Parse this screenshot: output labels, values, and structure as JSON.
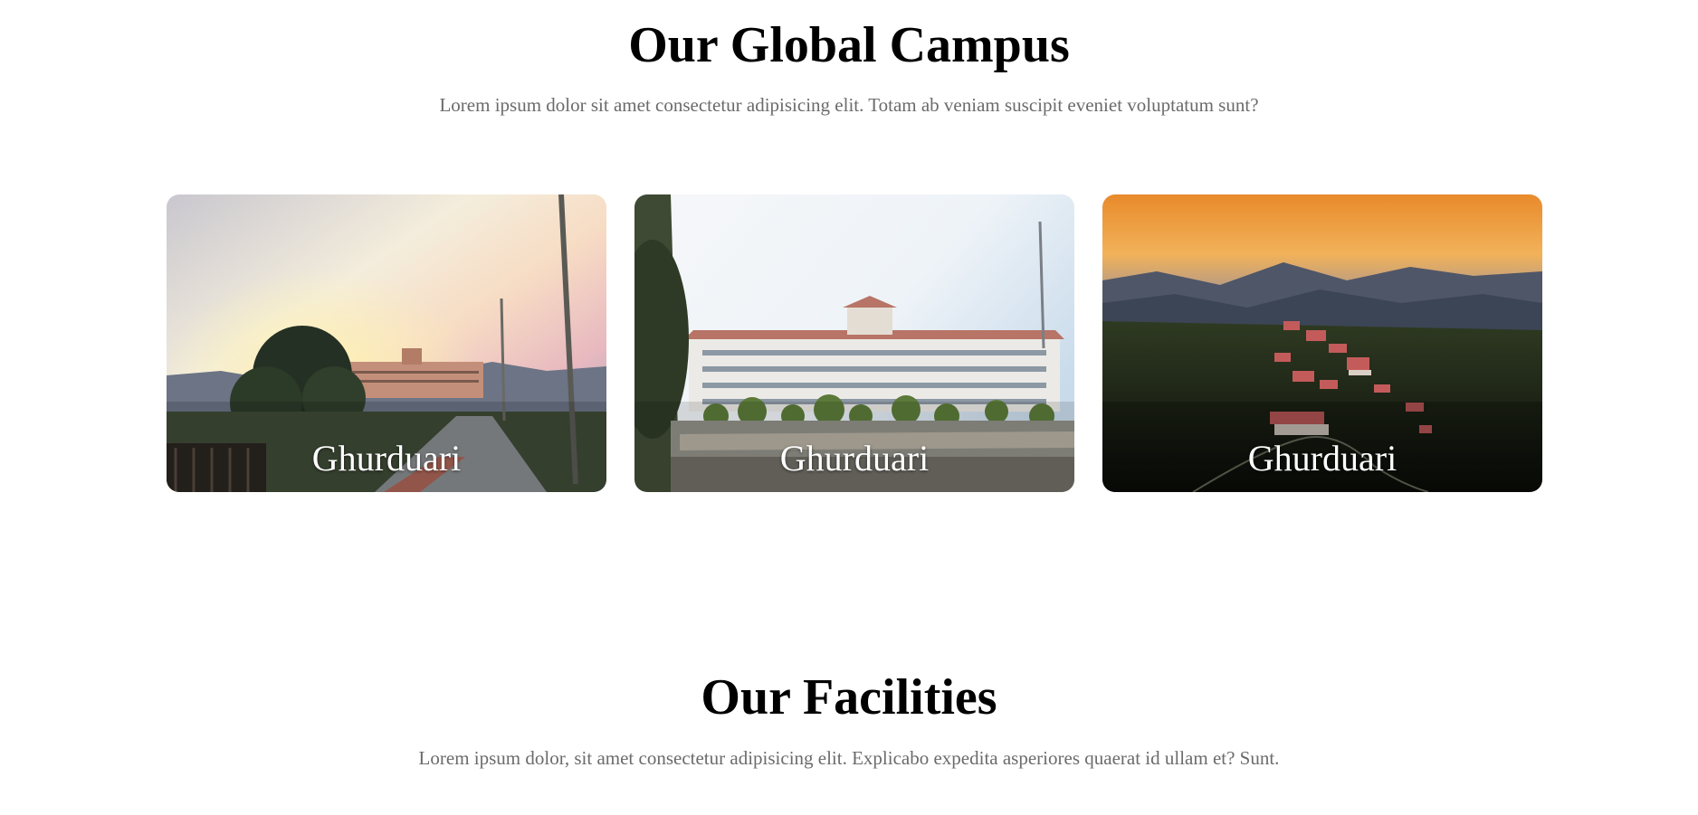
{
  "campus": {
    "title": "Our Global Campus",
    "subtitle": "Lorem ipsum dolor sit amet consectetur adipisicing elit. Totam ab veniam suscipit eveniet voluptatum sunt?",
    "cards": [
      {
        "label": "Ghurduari",
        "image": "campus-road-sunset-photo"
      },
      {
        "label": "Ghurduari",
        "image": "campus-main-building-photo"
      },
      {
        "label": "Ghurduari",
        "image": "campus-aerial-mountains-photo"
      }
    ]
  },
  "facilities": {
    "title": "Our Facilities",
    "subtitle": "Lorem ipsum dolor, sit amet consectetur adipisicing elit. Explicabo expedita asperiores quaerat id ullam et? Sunt."
  },
  "colors": {
    "title": "#000000",
    "subtitle": "#6b6b6b",
    "card_label": "#ffffff",
    "background": "#ffffff"
  }
}
